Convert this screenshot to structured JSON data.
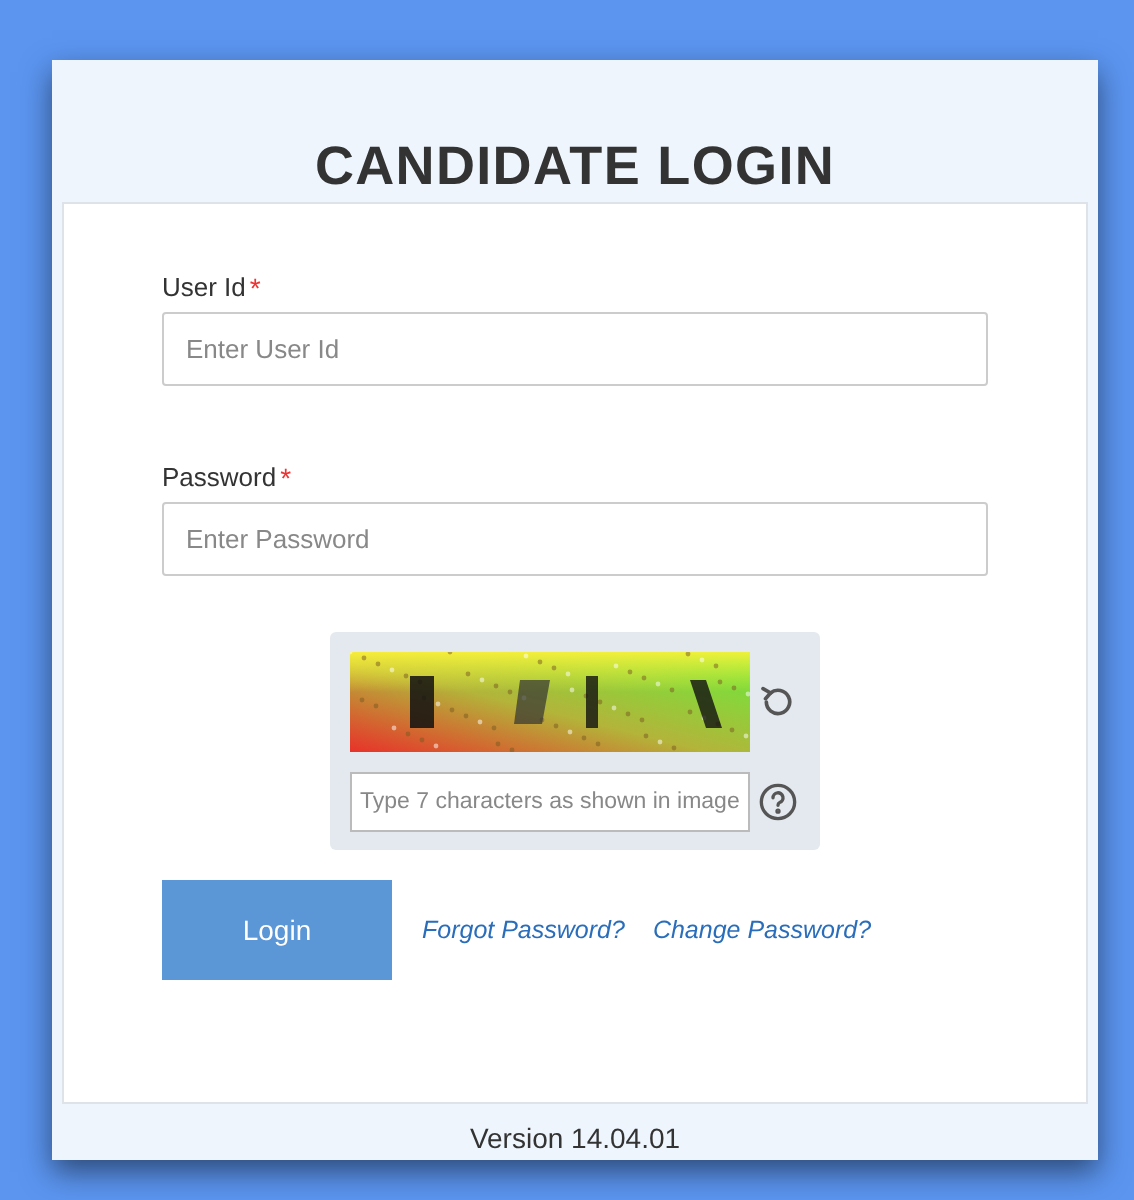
{
  "title": "CANDIDATE LOGIN",
  "fields": [
    {
      "label": "User Id",
      "required_mark": "*",
      "placeholder": "Enter User Id"
    },
    {
      "label": "Password",
      "required_mark": "*",
      "placeholder": "Enter Password"
    }
  ],
  "captcha": {
    "placeholder": "Type 7 characters as shown in image"
  },
  "login_button": "Login",
  "links": [
    "Forgot Password?",
    "Change Password?"
  ],
  "version": "Version 14.04.01"
}
